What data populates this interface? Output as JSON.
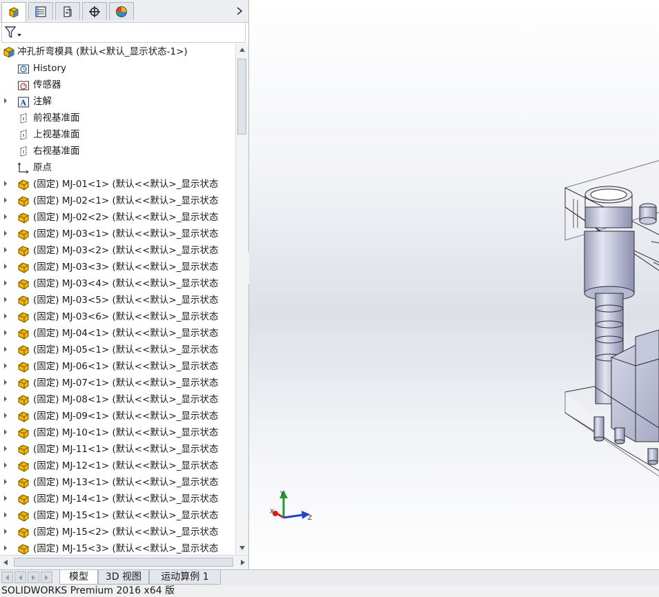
{
  "manager_tabs": [
    {
      "name": "FeatureManager",
      "icon": "feature-manager-icon",
      "active": true
    },
    {
      "name": "PropertyManager",
      "icon": "property-manager-icon",
      "active": false
    },
    {
      "name": "ConfigurationManager",
      "icon": "configuration-manager-icon",
      "active": false
    },
    {
      "name": "DimXpertManager",
      "icon": "dimxpert-icon",
      "active": false
    },
    {
      "name": "DisplayManager",
      "icon": "display-manager-icon",
      "active": false
    }
  ],
  "filter": {
    "icon": "filter-icon"
  },
  "tree": {
    "root": {
      "label": "冲孔折弯模具 (默认<默认_显示状态-1>)",
      "icon": "assembly-icon"
    },
    "items": [
      {
        "label": "History",
        "icon": "history-icon",
        "expandable": false
      },
      {
        "label": "传感器",
        "icon": "sensor-icon",
        "expandable": false
      },
      {
        "label": "注解",
        "icon": "annotation-icon",
        "expandable": true
      },
      {
        "label": "前视基准面",
        "icon": "plane-icon",
        "expandable": false
      },
      {
        "label": "上视基准面",
        "icon": "plane-icon",
        "expandable": false
      },
      {
        "label": "右视基准面",
        "icon": "plane-icon",
        "expandable": false
      },
      {
        "label": "原点",
        "icon": "origin-icon",
        "expandable": false
      },
      {
        "label": "(固定) MJ-01<1> (默认<<默认>_显示状态",
        "icon": "part-icon",
        "expandable": true
      },
      {
        "label": "(固定) MJ-02<1> (默认<<默认>_显示状态",
        "icon": "part-icon",
        "expandable": true
      },
      {
        "label": "(固定) MJ-02<2> (默认<<默认>_显示状态",
        "icon": "part-icon",
        "expandable": true
      },
      {
        "label": "(固定) MJ-03<1> (默认<<默认>_显示状态",
        "icon": "part-icon",
        "expandable": true
      },
      {
        "label": "(固定) MJ-03<2> (默认<<默认>_显示状态",
        "icon": "part-icon",
        "expandable": true
      },
      {
        "label": "(固定) MJ-03<3> (默认<<默认>_显示状态",
        "icon": "part-icon",
        "expandable": true
      },
      {
        "label": "(固定) MJ-03<4> (默认<<默认>_显示状态",
        "icon": "part-icon",
        "expandable": true
      },
      {
        "label": "(固定) MJ-03<5> (默认<<默认>_显示状态",
        "icon": "part-icon",
        "expandable": true
      },
      {
        "label": "(固定) MJ-03<6> (默认<<默认>_显示状态",
        "icon": "part-icon",
        "expandable": true
      },
      {
        "label": "(固定) MJ-04<1> (默认<<默认>_显示状态",
        "icon": "part-icon",
        "expandable": true
      },
      {
        "label": "(固定) MJ-05<1> (默认<<默认>_显示状态",
        "icon": "part-icon",
        "expandable": true
      },
      {
        "label": "(固定) MJ-06<1> (默认<<默认>_显示状态",
        "icon": "part-icon",
        "expandable": true
      },
      {
        "label": "(固定) MJ-07<1> (默认<<默认>_显示状态",
        "icon": "part-icon",
        "expandable": true
      },
      {
        "label": "(固定) MJ-08<1> (默认<<默认>_显示状态",
        "icon": "part-icon",
        "expandable": true
      },
      {
        "label": "(固定) MJ-09<1> (默认<<默认>_显示状态",
        "icon": "part-icon",
        "expandable": true
      },
      {
        "label": "(固定) MJ-10<1> (默认<<默认>_显示状态",
        "icon": "part-icon",
        "expandable": true
      },
      {
        "label": "(固定) MJ-11<1> (默认<<默认>_显示状态",
        "icon": "part-icon",
        "expandable": true
      },
      {
        "label": "(固定) MJ-12<1> (默认<<默认>_显示状态",
        "icon": "part-icon",
        "expandable": true
      },
      {
        "label": "(固定) MJ-13<1> (默认<<默认>_显示状态",
        "icon": "part-icon",
        "expandable": true
      },
      {
        "label": "(固定) MJ-14<1> (默认<<默认>_显示状态",
        "icon": "part-icon",
        "expandable": true
      },
      {
        "label": "(固定) MJ-15<1> (默认<<默认>_显示状态",
        "icon": "part-icon",
        "expandable": true
      },
      {
        "label": "(固定) MJ-15<2> (默认<<默认>_显示状态",
        "icon": "part-icon",
        "expandable": true
      },
      {
        "label": "(固定) MJ-15<3> (默认<<默认>_显示状态",
        "icon": "part-icon",
        "expandable": true
      }
    ]
  },
  "triad": {
    "x_label": "X",
    "y_label": "Y",
    "z_label": "Z"
  },
  "bottom_tabs": [
    {
      "label": "模型",
      "active": true
    },
    {
      "label": "3D 视图",
      "active": false
    },
    {
      "label": "运动算例 1",
      "active": false
    }
  ],
  "status_bar": {
    "text": "SOLIDWORKS Premium 2016 x64 版"
  },
  "colors": {
    "part_icon": "#f2b705",
    "assembly_icon": "#f2b705",
    "triad_x": "#d21f1f",
    "triad_y": "#1f9a2b",
    "triad_z": "#2140d2",
    "model_fill": "#c9cbe0",
    "model_edge": "#2b2b33"
  }
}
